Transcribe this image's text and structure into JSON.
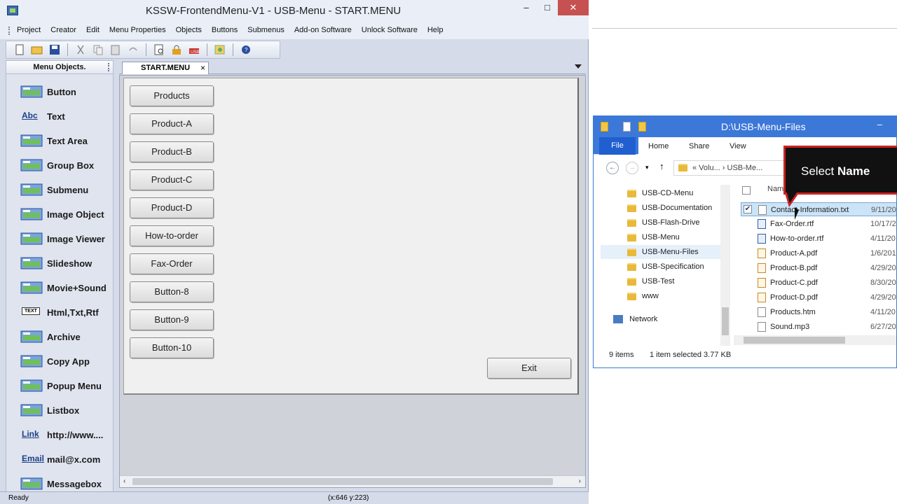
{
  "app": {
    "title": "KSSW-FrontendMenu-V1  -  USB-Menu  -  START.MENU",
    "menu": [
      "Project",
      "Creator",
      "Edit",
      "Menu Properties",
      "Objects",
      "Buttons",
      "Submenus",
      "Add-on Software",
      "Unlock Software",
      "Help"
    ],
    "panel_title": "Menu Objects.",
    "objects": [
      {
        "label": "Button",
        "icon": "button-object-icon"
      },
      {
        "label": "Text",
        "icon": "text-abc-icon"
      },
      {
        "label": "Text Area",
        "icon": "text-area-icon"
      },
      {
        "label": "Group Box",
        "icon": "group-box-icon"
      },
      {
        "label": "Submenu",
        "icon": "submenu-icon"
      },
      {
        "label": "Image Object",
        "icon": "image-object-icon"
      },
      {
        "label": "Image Viewer",
        "icon": "image-viewer-icon"
      },
      {
        "label": "Slideshow",
        "icon": "slideshow-icon"
      },
      {
        "label": "Movie+Sound",
        "icon": "movie-sound-icon"
      },
      {
        "label": "Html,Txt,Rtf",
        "icon": "html-txt-rtf-icon"
      },
      {
        "label": "Archive",
        "icon": "archive-icon"
      },
      {
        "label": "Copy App",
        "icon": "copy-app-icon"
      },
      {
        "label": "Popup Menu",
        "icon": "popup-menu-icon"
      },
      {
        "label": "Listbox",
        "icon": "listbox-icon"
      },
      {
        "label": "http://www....",
        "icon": "link-icon"
      },
      {
        "label": "mail@x.com",
        "icon": "email-icon"
      },
      {
        "label": "Messagebox",
        "icon": "messagebox-icon"
      }
    ],
    "object_icon_text": {
      "text": "Abc",
      "link": "Link",
      "email": "Email",
      "html": "TEXT"
    },
    "doc_tab": "START.MENU",
    "doc_tab_close": "×",
    "form_buttons": [
      "Products",
      "Product-A",
      "Product-B",
      "Product-C",
      "Product-D",
      "How-to-order",
      "Fax-Order",
      "Button-8",
      "Button-9",
      "Button-10"
    ],
    "exit_button": "Exit",
    "status_left": "Ready",
    "status_coords": "(x:646 y:223)",
    "colors": {
      "accent": "#3c78d8",
      "callout_border": "#cc2222"
    }
  },
  "explorer": {
    "title": "D:\\USB-Menu-Files",
    "minimize": "–",
    "ribbon_tabs": [
      "File",
      "Home",
      "Share",
      "View"
    ],
    "address": "« Volu... › USB-Me...",
    "nav_tree": [
      {
        "label": "USB-CD-Menu",
        "selected": false
      },
      {
        "label": "USB-Documentation",
        "selected": false
      },
      {
        "label": "USB-Flash-Drive",
        "selected": false
      },
      {
        "label": "USB-Menu",
        "selected": false
      },
      {
        "label": "USB-Menu-Files",
        "selected": true
      },
      {
        "label": "USB-Specification",
        "selected": false
      },
      {
        "label": "USB-Test",
        "selected": false
      },
      {
        "label": "www",
        "selected": false
      }
    ],
    "network": "Network",
    "column_name": "Name",
    "files": [
      {
        "name": "Contact-Information.txt",
        "date": "9/11/20",
        "type": "txt",
        "selected": true
      },
      {
        "name": "Fax-Order.rtf",
        "date": "10/17/2",
        "type": "rtf",
        "selected": false
      },
      {
        "name": "How-to-order.rtf",
        "date": "4/11/20",
        "type": "rtf",
        "selected": false
      },
      {
        "name": "Product-A.pdf",
        "date": "1/6/201",
        "type": "pdf",
        "selected": false
      },
      {
        "name": "Product-B.pdf",
        "date": "4/29/20",
        "type": "pdf",
        "selected": false
      },
      {
        "name": "Product-C.pdf",
        "date": "8/30/20",
        "type": "pdf",
        "selected": false
      },
      {
        "name": "Product-D.pdf",
        "date": "4/29/20",
        "type": "pdf",
        "selected": false
      },
      {
        "name": "Products.htm",
        "date": "4/11/20",
        "type": "htm",
        "selected": false
      },
      {
        "name": "Sound.mp3",
        "date": "6/27/20",
        "type": "mp3",
        "selected": false
      }
    ],
    "status_items": "9 items",
    "status_selected": "1 item selected  3.77 KB",
    "callout_prefix": "Select ",
    "callout_bold": "Name"
  }
}
